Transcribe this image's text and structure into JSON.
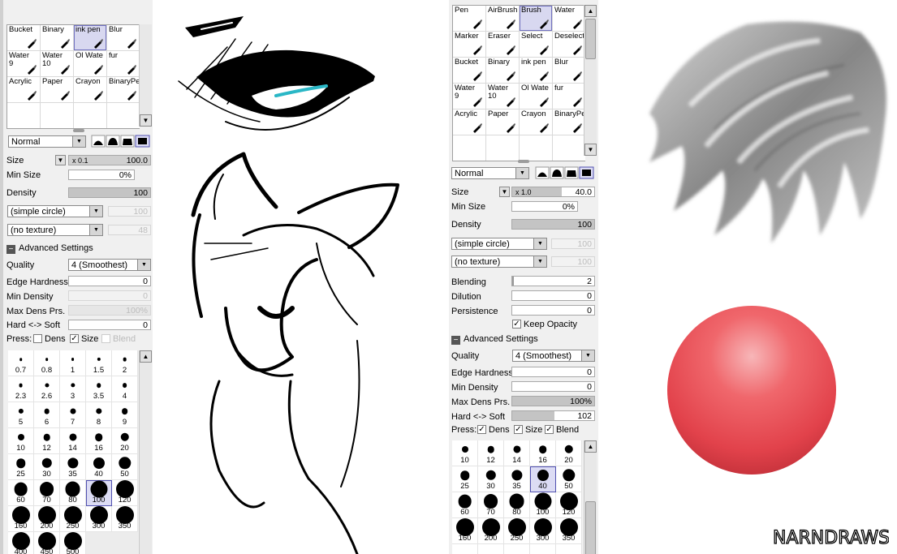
{
  "left_panel": {
    "tools": [
      {
        "label": "Bucket"
      },
      {
        "label": "Binary"
      },
      {
        "label": "ink pen",
        "selected": true
      },
      {
        "label": "Blur"
      },
      {
        "label": "Water\n9"
      },
      {
        "label": "Water\n10"
      },
      {
        "label": "Ol Wate"
      },
      {
        "label": "fur"
      },
      {
        "label": "Acrylic"
      },
      {
        "label": "Paper"
      },
      {
        "label": "Crayon"
      },
      {
        "label": "BinaryPe"
      },
      {
        "label": ""
      },
      {
        "label": ""
      },
      {
        "label": ""
      },
      {
        "label": ""
      }
    ],
    "blend_mode": "Normal",
    "size_label": "Size",
    "size_multiplier": "x 0.1",
    "size_value": "100.0",
    "min_size_label": "Min Size",
    "min_size_value": "0%",
    "density_label": "Density",
    "density_value": "100",
    "shape_dropdown": "(simple circle)",
    "shape_value": "100",
    "texture_dropdown": "(no texture)",
    "texture_value": "48",
    "advanced_label": "Advanced Settings",
    "quality_label": "Quality",
    "quality_value": "4 (Smoothest)",
    "edge_hardness_label": "Edge Hardness",
    "edge_hardness_value": "0",
    "min_density_label": "Min Density",
    "min_density_value": "0",
    "max_dens_label": "Max Dens Prs.",
    "max_dens_value": "100%",
    "hard_soft_label": "Hard <-> Soft",
    "hard_soft_value": "0",
    "press_label": "Press:",
    "press_dens": "Dens",
    "press_size": "Size",
    "press_blend": "Blend",
    "sizes": [
      "0.7",
      "0.8",
      "1",
      "1.5",
      "2",
      "2.3",
      "2.6",
      "3",
      "3.5",
      "4",
      "5",
      "6",
      "7",
      "8",
      "9",
      "10",
      "12",
      "14",
      "16",
      "20",
      "25",
      "30",
      "35",
      "40",
      "50",
      "60",
      "70",
      "80",
      "100",
      "120",
      "160",
      "200",
      "250",
      "300",
      "350",
      "400",
      "450",
      "500"
    ],
    "selected_size": "100"
  },
  "right_panel": {
    "tools": [
      {
        "label": "Pen"
      },
      {
        "label": "AirBrush"
      },
      {
        "label": "Brush",
        "selected": true
      },
      {
        "label": "Water"
      },
      {
        "label": "Marker"
      },
      {
        "label": "Eraser"
      },
      {
        "label": "Select"
      },
      {
        "label": "Deselect"
      },
      {
        "label": "Bucket"
      },
      {
        "label": "Binary"
      },
      {
        "label": "ink pen"
      },
      {
        "label": "Blur"
      },
      {
        "label": "Water\n9"
      },
      {
        "label": "Water\n10"
      },
      {
        "label": "Ol Wate"
      },
      {
        "label": "fur"
      },
      {
        "label": "Acrylic"
      },
      {
        "label": "Paper"
      },
      {
        "label": "Crayon"
      },
      {
        "label": "BinaryPe"
      },
      {
        "label": ""
      },
      {
        "label": ""
      },
      {
        "label": ""
      },
      {
        "label": ""
      }
    ],
    "blend_mode": "Normal",
    "size_label": "Size",
    "size_multiplier": "x 1.0",
    "size_value": "40.0",
    "min_size_label": "Min Size",
    "min_size_value": "0%",
    "density_label": "Density",
    "density_value": "100",
    "shape_dropdown": "(simple circle)",
    "shape_value": "100",
    "texture_dropdown": "(no texture)",
    "texture_value": "100",
    "blending_label": "Blending",
    "blending_value": "2",
    "dilution_label": "Dilution",
    "dilution_value": "0",
    "persistence_label": "Persistence",
    "persistence_value": "0",
    "keep_opacity_label": "Keep Opacity",
    "advanced_label": "Advanced Settings",
    "quality_label": "Quality",
    "quality_value": "4 (Smoothest)",
    "edge_hardness_label": "Edge Hardness",
    "edge_hardness_value": "0",
    "min_density_label": "Min Density",
    "min_density_value": "0",
    "max_dens_label": "Max Dens Prs.",
    "max_dens_value": "100%",
    "hard_soft_label": "Hard <-> Soft",
    "hard_soft_value": "102",
    "press_label": "Press:",
    "press_dens": "Dens",
    "press_size": "Size",
    "press_blend": "Blend",
    "sizes": [
      "10",
      "12",
      "14",
      "16",
      "20",
      "25",
      "30",
      "35",
      "40",
      "50",
      "60",
      "70",
      "80",
      "100",
      "120",
      "160",
      "200",
      "250",
      "300",
      "350",
      "",
      "",
      "",
      "",
      ""
    ],
    "selected_size": "40"
  },
  "signature": "NARNDRAWS",
  "colors": {
    "panel_bg": "#f0f0f0",
    "selection": "#d8d8f0",
    "ball": "#e8505a"
  }
}
